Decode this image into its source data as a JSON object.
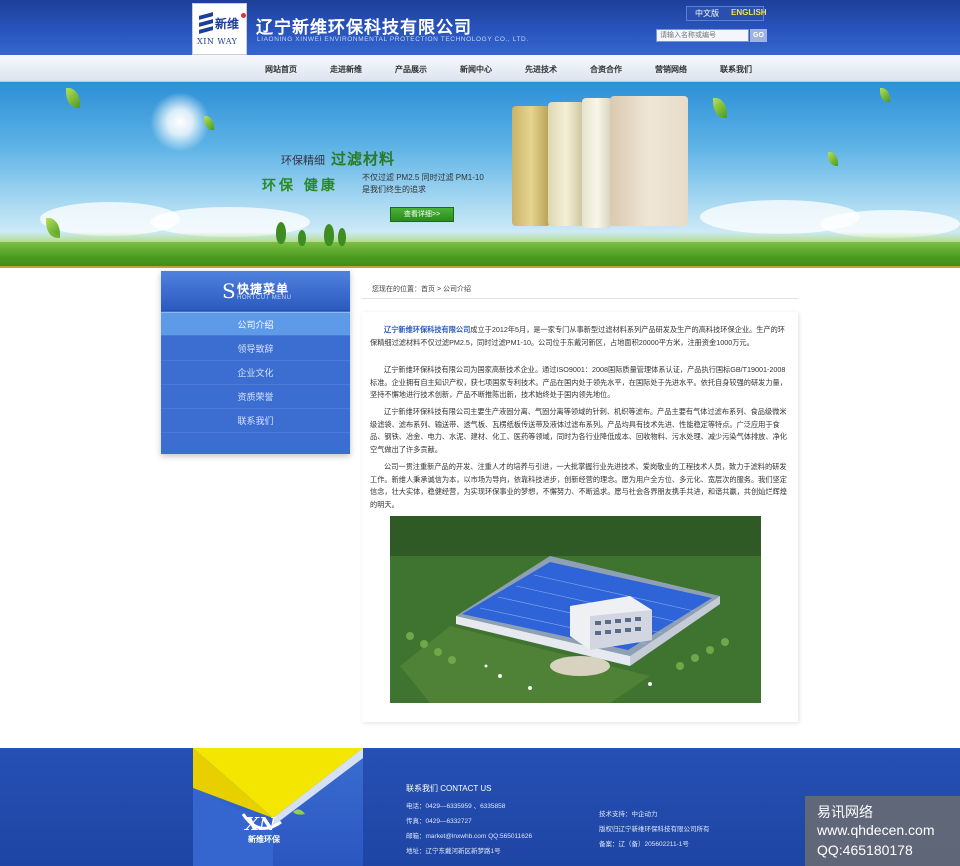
{
  "header": {
    "logo_cn": "新维",
    "logo_en": "XIN WAY",
    "company_cn": "辽宁新维环保科技有限公司",
    "company_en": "LIAONING XINWEI ENVIRONMENTAL PROTECTION TECHNOLOGY CO., LTD.",
    "lang_cn": "中文版",
    "lang_en": "ENGLISH",
    "search_placeholder": "请输入名称或编号",
    "search_button": "GO"
  },
  "nav": {
    "items": [
      {
        "label": "网站首页"
      },
      {
        "label": "走进新维"
      },
      {
        "label": "产品展示"
      },
      {
        "label": "新闻中心"
      },
      {
        "label": "先进技术"
      },
      {
        "label": "合资合作"
      },
      {
        "label": "营销网络"
      },
      {
        "label": "联系我们"
      }
    ]
  },
  "banner": {
    "line1_small": "环保精细",
    "line1_big": "过滤材料",
    "line2_big": "环保 健康",
    "line2_a": "不仅过滤 PM2.5  同时过滤 PM1-10",
    "line2_b": "是我们终生的追求",
    "detail_button": "查看详细>>"
  },
  "sidebar": {
    "s_letter": "S",
    "title": "快捷菜单",
    "subtitle": "HORTCUT MENU",
    "items": [
      {
        "label": "公司介绍",
        "active": true
      },
      {
        "label": "领导致辞",
        "active": false
      },
      {
        "label": "企业文化",
        "active": false
      },
      {
        "label": "资质荣誉",
        "active": false
      },
      {
        "label": "联系我们",
        "active": false
      }
    ]
  },
  "breadcrumb": {
    "prefix": "您现在的位置：",
    "home": "首页",
    "separator": ">",
    "current": "公司介绍"
  },
  "content": {
    "p1_name": "辽宁新维环保科技有限公司",
    "p1_rest": "成立于2012年5月，是一家专门从事新型过滤材料系列产品研发及生产的高科技环保企业。生产的环保精细过滤材料不仅过滤PM2.5，同时过滤PM1-10。公司位于东戴河新区，占地面积20000平方米，注册资金1000万元。",
    "p2": "辽宁新维环保科技有限公司为国家高新技术企业。通过ISO9001：2008国际质量管理体系认证，产品执行国标GB/T19001-2008标准。企业拥有自主知识产权，获七项国家专利技术。产品在国内处于领先水平，在国际处于先进水平。依托自身较强的研发力量，坚持不懈地进行技术创新，产品不断推陈出新，技术始终处于国内领先地位。",
    "p3": "辽宁新维环保科技有限公司主要生产液固分离、气固分离等领域的针刺、机织等滤布。产品主要有气体过滤布系列、食品级微米级滤袋、滤布系列、输送带、透气板、瓦楞纸板传送带及液体过滤布系列。产品均具有技术先进、性能稳定等特点。广泛应用于食品、钢铁、冶金、电力、水泥、建材、化工、医药等领域，同时为各行业降低成本、回收物料、污水处理、减少污染气体排放、净化空气做出了许多贡献。",
    "p4": "公司一贯注重新产品的开发、注重人才的培养与引进，一大批掌握行业先进技术、爱岗敬业的工程技术人员，致力于滤料的研发工作。新维人秉承诚信为本，以市场为导向，依靠科技进步，创新经营的理念。愿为用户全方位、多元化、宽层次的服务。我们坚定信念，壮大实体，稳健经营，为实现环保事业的梦想，不懈努力、不断追求。愿与社会各界朋友携手共进，和谐共赢，共创灿烂辉煌的明天。"
  },
  "footer": {
    "logo_text": "新维环保",
    "contact_title": "联系我们 CONTACT  US",
    "phone": "电话：0429—6335959 、6335858",
    "fax": "传真：0429—6332727",
    "email": "邮箱：market@lnxwhb.com   QQ:565011626",
    "address": "地址：辽宁东戴河新区新梦路1号",
    "tech_support": "技术支持：中企动力",
    "copyright": "版权归辽宁新维环保科技有限公司所有",
    "icp": "备案：辽（备）205602211-1号"
  },
  "watermark": {
    "line1": "易讯网络",
    "line2": "www.qhdecen.com",
    "line3": "QQ:465180178"
  },
  "colors": {
    "header_blue": "#2a56c0",
    "accent_blue": "#3b6ed0",
    "active_item": "#5d9ae8",
    "green_button": "#2a8a1f"
  }
}
